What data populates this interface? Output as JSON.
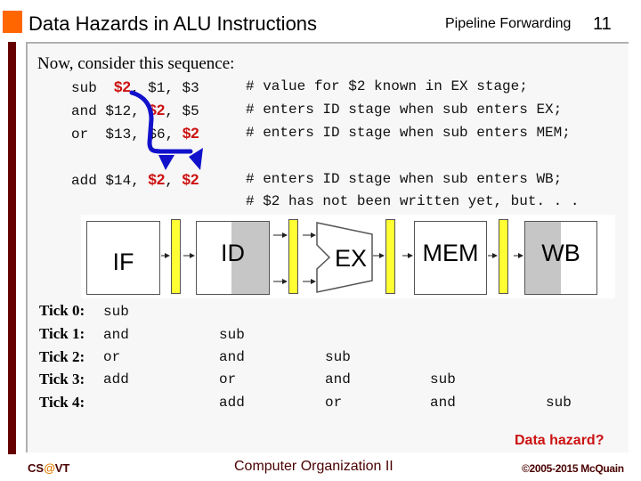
{
  "header": {
    "title": "Data Hazards in ALU Instructions",
    "section": "Pipeline Forwarding",
    "page_number": "11"
  },
  "intro": "Now, consider this sequence:",
  "code": [
    {
      "pre": "sub  ",
      "r1": "$2",
      "mid": ", $1, $3   ",
      "r2": "",
      "mid2": "",
      "comment": "# value for $2 known in EX stage;"
    },
    {
      "pre": "and $12, ",
      "r1": "$2",
      "mid": ", $5   ",
      "r2": "",
      "mid2": "",
      "comment": "# enters ID stage when sub enters EX;"
    },
    {
      "pre": "or  $13, $6, ",
      "r1": "$2",
      "mid": "   ",
      "r2": "",
      "mid2": "",
      "comment": "# enters ID stage when sub enters MEM;"
    },
    {
      "pre": "add $14, ",
      "r1": "$2",
      "mid": ", ",
      "r2": "$2",
      "mid2": "   ",
      "comment": "# enters ID stage when sub enters WB;"
    },
    {
      "pre": "",
      "r1": "",
      "mid": "",
      "r2": "",
      "mid2": "",
      "comment": "# $2 has not been written yet, but. . ."
    }
  ],
  "pipeline": {
    "stages": [
      "IF",
      "ID",
      "EX",
      "MEM",
      "WB"
    ]
  },
  "ticks": [
    {
      "label": "Tick 0:",
      "IF": "sub",
      "ID": "",
      "EX": "",
      "MEM": "",
      "WB": ""
    },
    {
      "label": "Tick 1:",
      "IF": "and",
      "ID": "sub",
      "EX": "",
      "MEM": "",
      "WB": ""
    },
    {
      "label": "Tick 2:",
      "IF": "or",
      "ID": "and",
      "EX": "sub",
      "MEM": "",
      "WB": ""
    },
    {
      "label": "Tick 3:",
      "IF": "add",
      "ID": "or",
      "EX": "and",
      "MEM": "sub",
      "WB": ""
    },
    {
      "label": "Tick 4:",
      "IF": "",
      "ID": "add",
      "EX": "or",
      "MEM": "and",
      "WB": "sub"
    }
  ],
  "hazard_note": "Data hazard?",
  "footer": {
    "left_prefix": "CS",
    "left_at": "@",
    "left_suffix": "VT",
    "center": "Computer Organization II",
    "right": "©2005-2015 McQuain"
  },
  "colors": {
    "accent_orange": "#ff6600",
    "sidebar_maroon": "#660000",
    "register_red": "#cc1111",
    "arrow_blue": "#1111cc",
    "latch_yellow": "#ffff33"
  }
}
